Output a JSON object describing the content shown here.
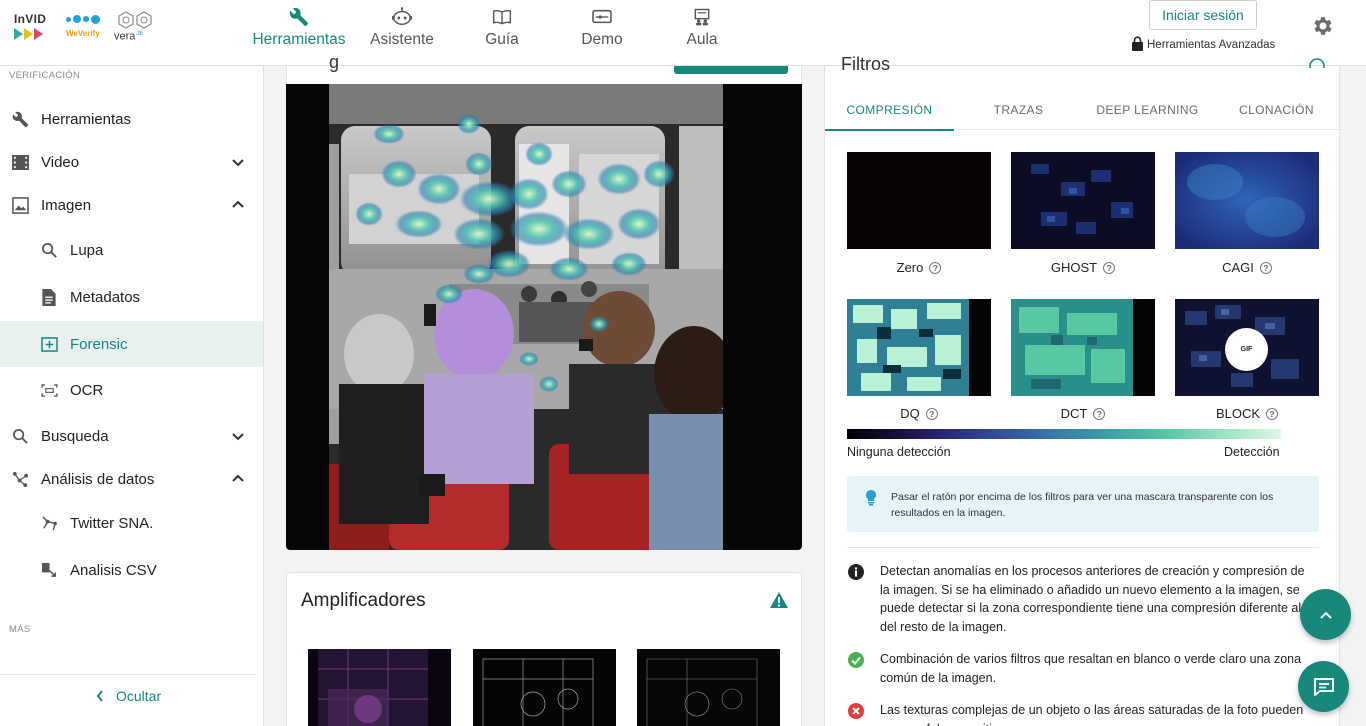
{
  "header": {
    "logos": {
      "invid": "InVID",
      "weverify": "WeVerify",
      "vera": "vera",
      "vera_suffix": ".ai"
    },
    "nav": [
      {
        "label": "Herramientas",
        "icon": "wrench-icon",
        "active": true
      },
      {
        "label": "Asistente",
        "icon": "robot-icon",
        "active": false
      },
      {
        "label": "Guía",
        "icon": "book-icon",
        "active": false
      },
      {
        "label": "Demo",
        "icon": "video-player-icon",
        "active": false
      },
      {
        "label": "Aula",
        "icon": "classroom-icon",
        "active": false
      }
    ],
    "login_label": "Iniciar sesión",
    "advanced_tools_label": "Herramientas Avanzadas"
  },
  "sidebar": {
    "section_verification": "VERIFICACIÓN",
    "section_more": "MÁS",
    "items": [
      {
        "label": "Herramientas",
        "icon": "wrench-icon"
      },
      {
        "label": "Video",
        "icon": "film-icon",
        "chevron": "down"
      },
      {
        "label": "Imagen",
        "icon": "image-icon",
        "chevron": "up"
      },
      {
        "label": "Lupa",
        "icon": "magnifier-icon",
        "sub": true
      },
      {
        "label": "Metadatos",
        "icon": "document-icon",
        "sub": true
      },
      {
        "label": "Forensic",
        "icon": "forensic-icon",
        "sub": true,
        "active": true
      },
      {
        "label": "OCR",
        "icon": "ocr-icon",
        "sub": true
      },
      {
        "label": "Busqueda",
        "icon": "search-icon",
        "chevron": "down"
      },
      {
        "label": "Análisis de datos",
        "icon": "data-analysis-icon",
        "chevron": "up"
      },
      {
        "label": "Twitter SNA.",
        "icon": "twitter-sna-icon",
        "sub": true
      },
      {
        "label": "Analisis CSV",
        "icon": "csv-icon",
        "sub": true
      }
    ],
    "hide_label": "Ocultar"
  },
  "main": {
    "image_card_title_fragment": "g",
    "amplifiers": {
      "title": "Amplificadores"
    }
  },
  "filters": {
    "title_fragment": "Filtros",
    "tabs": [
      {
        "label": "COMPRESIÓN",
        "active": true
      },
      {
        "label": "TRAZAS",
        "active": false
      },
      {
        "label": "DEEP LEARNING",
        "active": false
      },
      {
        "label": "CLONACIÓN",
        "active": false
      }
    ],
    "thumbnails": [
      {
        "label": "Zero"
      },
      {
        "label": "GHOST"
      },
      {
        "label": "CAGI"
      },
      {
        "label": "DQ"
      },
      {
        "label": "DCT"
      },
      {
        "label": "BLOCK",
        "badge": "GIF"
      }
    ],
    "scale": {
      "left_label": "Ninguna detección",
      "right_label": "Detección"
    },
    "info_text": "Pasar el ratón por encima de los filtros para ver una mascara transparente con los resultados en la imagen.",
    "descriptions": [
      {
        "icon": "info-icon",
        "text": "Detectan anomalías en los procesos anteriores de creación y compresión de la imagen. Si se ha eliminado o añadido un nuevo elemento a la imagen, se puede detectar si la zona correspondiente tiene una compresión diferente al del resto de la imagen."
      },
      {
        "icon": "check-icon",
        "text": "Combinación de varios filtros que resaltan en blanco o verde claro una zona común de la imagen."
      },
      {
        "icon": "cross-icon",
        "text": "Las texturas complejas de un objeto o las áreas saturadas de la foto pueden generar falsos positivos."
      }
    ]
  },
  "colors": {
    "accent": "#17887a",
    "info_bg": "#e6f3f8",
    "active_bg": "#e8f1ef"
  }
}
